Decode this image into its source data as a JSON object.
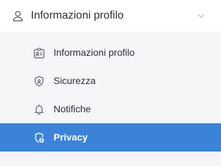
{
  "section": {
    "title": "Informazioni profilo",
    "user_icon": "user-icon",
    "chevron_icon": "chevron-down-icon"
  },
  "submenu": {
    "items": [
      {
        "label": "Informazioni profilo",
        "icon": "id-card-icon",
        "active": false
      },
      {
        "label": "Sicurezza",
        "icon": "shield-icon",
        "active": false
      },
      {
        "label": "Notifiche",
        "icon": "bell-icon",
        "active": false
      },
      {
        "label": "Privacy",
        "icon": "privacy-icon",
        "active": true
      }
    ]
  },
  "colors": {
    "active_bg": "#3a83d9",
    "submenu_bg": "#f5f6f8",
    "text": "#2b2f36"
  }
}
